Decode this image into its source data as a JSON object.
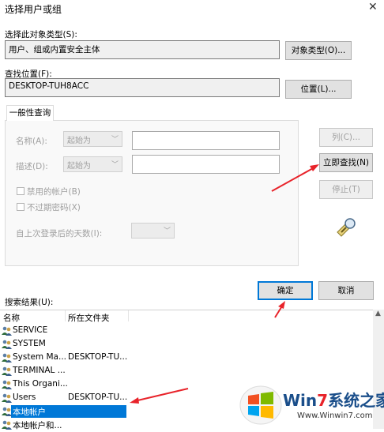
{
  "window": {
    "title": "选择用户或组",
    "close_glyph": "✕"
  },
  "object_type": {
    "label": "选择此对象类型(S):",
    "value": "用户、组或内置安全主体",
    "button": "对象类型(O)..."
  },
  "location": {
    "label": "查找位置(F):",
    "value": "DESKTOP-TUH8ACC",
    "button": "位置(L)..."
  },
  "query": {
    "tab": "一般性查询",
    "name_label": "名称(A):",
    "name_mode": "起始为",
    "desc_label": "描述(D):",
    "desc_mode": "起始为",
    "disabled_accounts": "禁用的帐户(B)",
    "non_expiring": "不过期密码(X)",
    "days_label": "自上次登录后的天数(I):"
  },
  "side_buttons": {
    "columns": "列(C)...",
    "find_now": "立即查找(N)",
    "stop": "停止(T)"
  },
  "actions": {
    "ok": "确定",
    "cancel": "取消"
  },
  "results": {
    "label": "搜索结果(U):",
    "columns": [
      "名称",
      "所在文件夹"
    ],
    "rows": [
      {
        "name": "SERVICE",
        "folder": ""
      },
      {
        "name": "SYSTEM",
        "folder": ""
      },
      {
        "name": "System Ma...",
        "folder": "DESKTOP-TU..."
      },
      {
        "name": "TERMINAL ...",
        "folder": ""
      },
      {
        "name": "This Organi...",
        "folder": ""
      },
      {
        "name": "Users",
        "folder": "DESKTOP-TU..."
      },
      {
        "name": "本地帐户",
        "folder": ""
      },
      {
        "name": "本地帐户和...",
        "folder": ""
      }
    ],
    "selected_index": 6
  },
  "watermark": {
    "brand_a": "Win",
    "brand_b": "7",
    "brand_c": "系统之家",
    "url": "Www.Winwin7.com"
  },
  "colors": {
    "accent": "#0078d7",
    "selection": "#0078d7",
    "annotation_arrow": "#e8232a"
  }
}
